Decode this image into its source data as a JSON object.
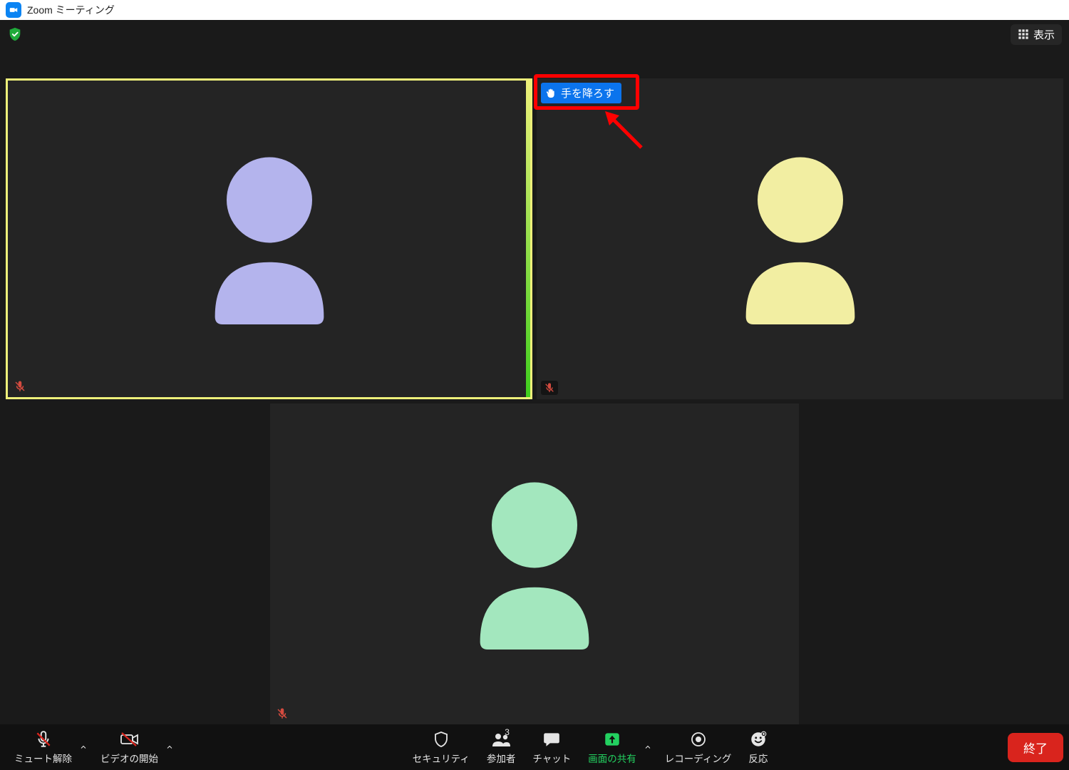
{
  "titlebar": {
    "title": "Zoom ミーティング"
  },
  "topbar": {
    "view_label": "表示"
  },
  "tiles": {
    "lower_hand_label": "手を降ろす",
    "colors": {
      "tile1_avatar": "#b4b4ed",
      "tile2_avatar": "#f2eea2",
      "tile3_avatar": "#a3e7be"
    }
  },
  "toolbar": {
    "unmute": "ミュート解除",
    "start_video": "ビデオの開始",
    "security": "セキュリティ",
    "participants": "参加者",
    "participants_count": "3",
    "chat": "チャット",
    "share": "画面の共有",
    "record": "レコーディング",
    "reactions": "反応",
    "end": "終了"
  }
}
